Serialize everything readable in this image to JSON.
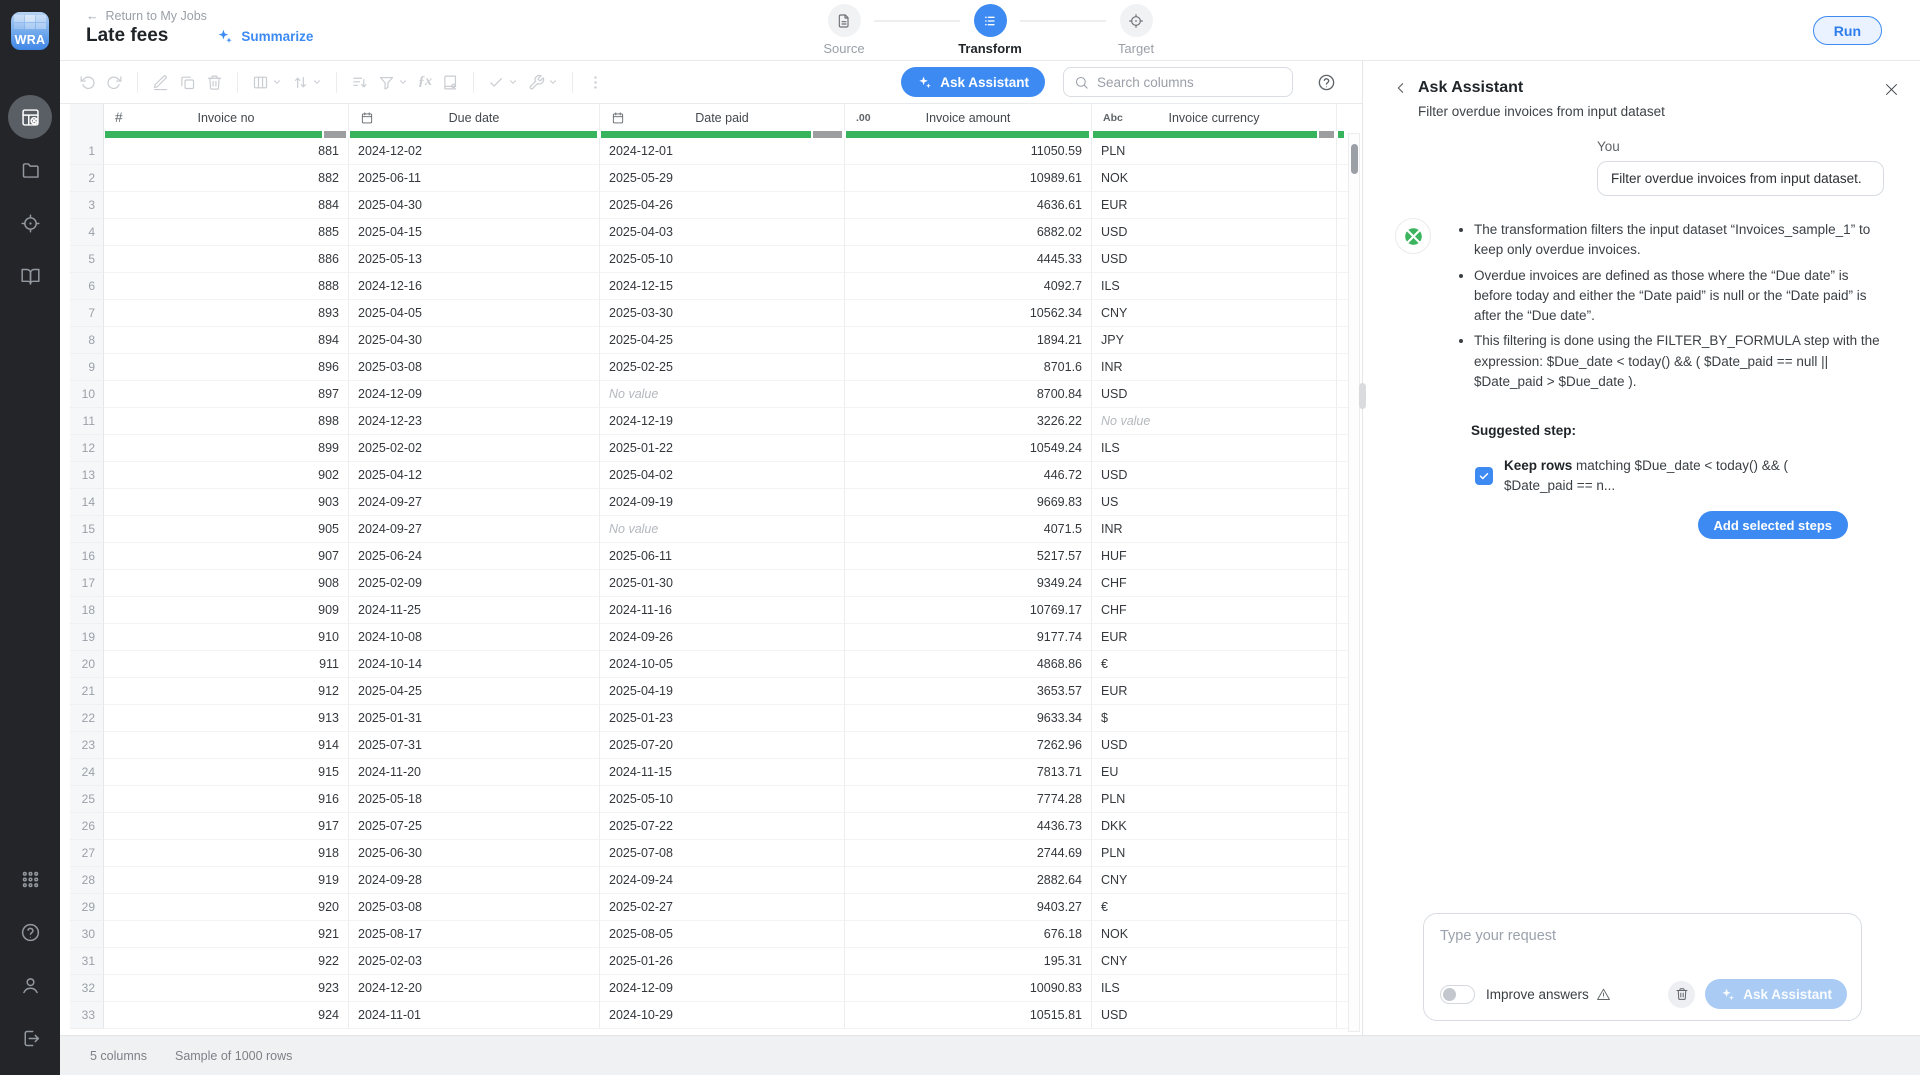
{
  "colors": {
    "accent_blue": "#3d8bf2",
    "green": "#38b45c",
    "bar_gray": "#9c9ea0"
  },
  "sidebar": {
    "logo": "WRA",
    "top_items": [
      {
        "name": "transform-jobs",
        "icon": "grid-edit",
        "active": true
      },
      {
        "name": "projects",
        "icon": "folder",
        "active": false
      },
      {
        "name": "targets",
        "icon": "crosshair",
        "active": false
      },
      {
        "name": "docs",
        "icon": "book-open",
        "active": false
      }
    ],
    "bottom_items": [
      {
        "name": "apps",
        "icon": "dots-grid",
        "active": false
      },
      {
        "name": "help",
        "icon": "help-circle",
        "active": false
      },
      {
        "name": "account",
        "icon": "user",
        "active": false
      },
      {
        "name": "logout",
        "icon": "log-out",
        "active": false
      }
    ]
  },
  "header": {
    "back_label": "Return to My Jobs",
    "back_arrow": "←",
    "title": "Late fees",
    "summarize_label": "Summarize",
    "run_label": "Run",
    "steps": [
      {
        "label": "Source",
        "icon": "file-doc",
        "active": false
      },
      {
        "label": "Transform",
        "icon": "list-steps",
        "active": true
      },
      {
        "label": "Target",
        "icon": "crosshair",
        "active": false
      }
    ]
  },
  "toolbar": {
    "groups": [
      [
        {
          "icon": "undo"
        },
        {
          "icon": "redo"
        }
      ],
      [
        {
          "icon": "pencil"
        },
        {
          "icon": "copy"
        },
        {
          "icon": "trash"
        }
      ],
      [
        {
          "icon": "columns",
          "chevron": true
        },
        {
          "icon": "sort",
          "chevron": true
        }
      ],
      [
        {
          "icon": "filter-lines"
        },
        {
          "icon": "funnel",
          "chevron": true
        },
        {
          "icon": "formula"
        },
        {
          "icon": "lookup-book"
        }
      ],
      [
        {
          "icon": "checks",
          "chevron": true
        },
        {
          "icon": "wrench",
          "chevron": true
        }
      ],
      [
        {
          "icon": "kebab"
        }
      ]
    ],
    "ask_assistant_label": "Ask Assistant",
    "search_placeholder": "Search columns"
  },
  "table": {
    "no_value_text": "No value",
    "columns": [
      {
        "icon_kind": "text",
        "icon": "#",
        "label": "Invoice no",
        "align": "right",
        "fill": 0.9
      },
      {
        "icon_kind": "calendar",
        "icon": "calendar",
        "label": "Due date",
        "align": "left",
        "fill": 1
      },
      {
        "icon_kind": "calendar",
        "icon": "calendar",
        "label": "Date paid",
        "align": "left",
        "fill": 0.87
      },
      {
        "icon_kind": "text",
        "icon": ".00",
        "label": "Invoice amount",
        "align": "right",
        "fill": 1
      },
      {
        "icon_kind": "text",
        "icon": "Abc",
        "label": "Invoice currency",
        "align": "left",
        "fill": 0.93
      }
    ],
    "rows": [
      [
        1,
        "881",
        "2024-12-02",
        "2024-12-01",
        "11050.59",
        "PLN"
      ],
      [
        2,
        "882",
        "2025-06-11",
        "2025-05-29",
        "10989.61",
        "NOK"
      ],
      [
        3,
        "884",
        "2025-04-30",
        "2025-04-26",
        "4636.61",
        "EUR"
      ],
      [
        4,
        "885",
        "2025-04-15",
        "2025-04-03",
        "6882.02",
        "USD"
      ],
      [
        5,
        "886",
        "2025-05-13",
        "2025-05-10",
        "4445.33",
        "USD"
      ],
      [
        6,
        "888",
        "2024-12-16",
        "2024-12-15",
        "4092.7",
        "ILS"
      ],
      [
        7,
        "893",
        "2025-04-05",
        "2025-03-30",
        "10562.34",
        "CNY"
      ],
      [
        8,
        "894",
        "2025-04-30",
        "2025-04-25",
        "1894.21",
        "JPY"
      ],
      [
        9,
        "896",
        "2025-03-08",
        "2025-02-25",
        "8701.6",
        "INR"
      ],
      [
        10,
        "897",
        "2024-12-09",
        "No value",
        "8700.84",
        "USD"
      ],
      [
        11,
        "898",
        "2024-12-23",
        "2024-12-19",
        "3226.22",
        "No value"
      ],
      [
        12,
        "899",
        "2025-02-02",
        "2025-01-22",
        "10549.24",
        "ILS"
      ],
      [
        13,
        "902",
        "2025-04-12",
        "2025-04-02",
        "446.72",
        "USD"
      ],
      [
        14,
        "903",
        "2024-09-27",
        "2024-09-19",
        "9669.83",
        "US"
      ],
      [
        15,
        "905",
        "2024-09-27",
        "No value",
        "4071.5",
        "INR"
      ],
      [
        16,
        "907",
        "2025-06-24",
        "2025-06-11",
        "5217.57",
        "HUF"
      ],
      [
        17,
        "908",
        "2025-02-09",
        "2025-01-30",
        "9349.24",
        "CHF"
      ],
      [
        18,
        "909",
        "2024-11-25",
        "2024-11-16",
        "10769.17",
        "CHF"
      ],
      [
        19,
        "910",
        "2024-10-08",
        "2024-09-26",
        "9177.74",
        "EUR"
      ],
      [
        20,
        "911",
        "2024-10-14",
        "2024-10-05",
        "4868.86",
        "€"
      ],
      [
        21,
        "912",
        "2025-04-25",
        "2025-04-19",
        "3653.57",
        "EUR"
      ],
      [
        22,
        "913",
        "2025-01-31",
        "2025-01-23",
        "9633.34",
        "$"
      ],
      [
        23,
        "914",
        "2025-07-31",
        "2025-07-20",
        "7262.96",
        "USD"
      ],
      [
        24,
        "915",
        "2024-11-20",
        "2024-11-15",
        "7813.71",
        "EU"
      ],
      [
        25,
        "916",
        "2025-05-18",
        "2025-05-10",
        "7774.28",
        "PLN"
      ],
      [
        26,
        "917",
        "2025-07-25",
        "2025-07-22",
        "4436.73",
        "DKK"
      ],
      [
        27,
        "918",
        "2025-06-30",
        "2025-07-08",
        "2744.69",
        "PLN"
      ],
      [
        28,
        "919",
        "2024-09-28",
        "2024-09-24",
        "2882.64",
        "CNY"
      ],
      [
        29,
        "920",
        "2025-03-08",
        "2025-02-27",
        "9403.27",
        "€"
      ],
      [
        30,
        "921",
        "2025-08-17",
        "2025-08-05",
        "676.18",
        "NOK"
      ],
      [
        31,
        "922",
        "2025-02-03",
        "2025-01-26",
        "195.31",
        "CNY"
      ],
      [
        32,
        "923",
        "2024-12-20",
        "2024-12-09",
        "10090.83",
        "ILS"
      ],
      [
        33,
        "924",
        "2024-11-01",
        "2024-10-29",
        "10515.81",
        "USD"
      ]
    ]
  },
  "status_bar": {
    "columns_label": "5 columns",
    "rows_label": "Sample of 1000 rows"
  },
  "assistant_panel": {
    "title": "Ask Assistant",
    "subtitle": "Filter overdue invoices from input dataset",
    "you_label": "You",
    "user_message": "Filter overdue invoices from input dataset.",
    "bullets": [
      "The transformation filters the input dataset “Invoices_sample_1” to keep only overdue invoices.",
      "Overdue invoices are defined as those where the “Due date” is before today and either the “Date paid” is null or the “Date paid” is after the “Due date”.",
      "This filtering is done using the FILTER_BY_FORMULA step with the expression: $Due_date < today() && ( $Date_paid == null || $Date_paid > $Due_date )."
    ],
    "suggested_step_label": "Suggested step:",
    "step_keep_bold": "Keep rows",
    "step_text": " matching $Due_date < today() && ( $Date_paid == n...",
    "add_steps_label": "Add selected steps",
    "input_placeholder": "Type your request",
    "improve_answers_label": "Improve answers",
    "ask_assistant_label": "Ask Assistant"
  }
}
